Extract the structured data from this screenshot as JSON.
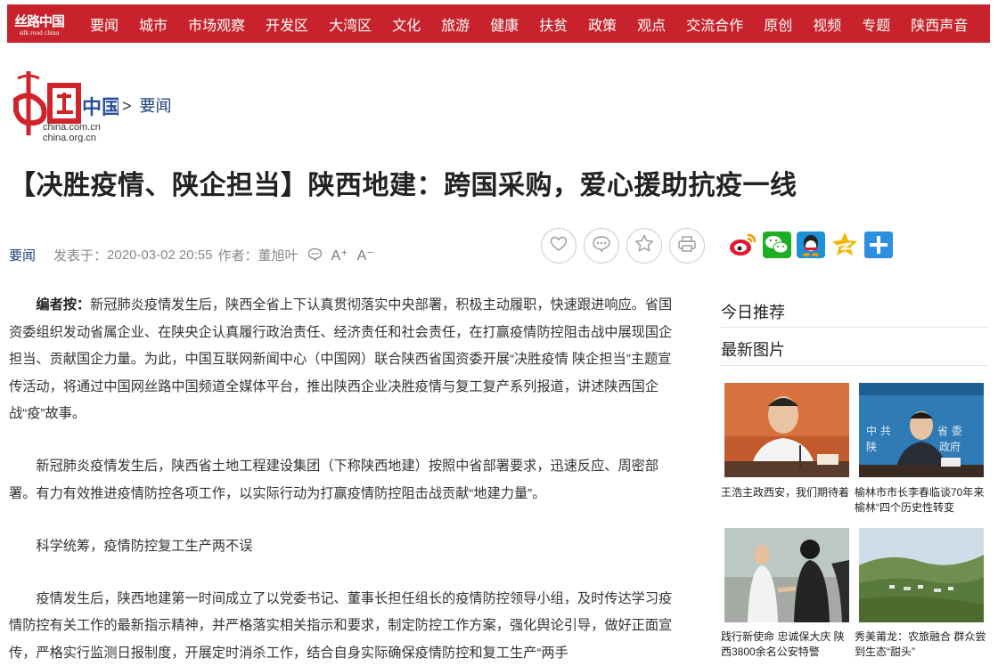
{
  "nav": {
    "logo_text": "丝路中国",
    "logo_sub": "silk road china",
    "items": [
      "要闻",
      "城市",
      "市场观察",
      "开发区",
      "大湾区",
      "文化",
      "旅游",
      "健康",
      "扶贫",
      "政策",
      "观点",
      "交流合作",
      "原创",
      "视频",
      "专题",
      "陕西声音"
    ]
  },
  "site": {
    "logo_main": "中国网",
    "logo_line1": "china.com.cn",
    "logo_line2": "china.org.cn"
  },
  "breadcrumb": {
    "sep": ">",
    "section": "要闻"
  },
  "article": {
    "title": "【决胜疫情、陕企担当】陕西地建：跨国采购，爱心援助抗疫一线",
    "column": "要闻",
    "published_label": "发表于：",
    "published": "2020-03-02 20:55",
    "author_label": "作者：",
    "author": "董旭叶",
    "font_up": "A⁺",
    "font_down": "A⁻",
    "editor_label": "编者按：",
    "editor_note": "新冠肺炎疫情发生后，陕西全省上下认真贯彻落实中央部署，积极主动履职，快速跟进响应。省国资委组织发动省属企业、在陕央企认真履行政治责任、经济责任和社会责任，在打赢疫情防控阻击战中展现国企担当、贡献国企力量。为此，中国互联网新闻中心（中国网）联合陕西省国资委开展“决胜疫情 陕企担当”主题宣传活动，将通过中国网丝路中国频道全媒体平台，推出陕西企业决胜疫情与复工复产系列报道，讲述陕西国企战“疫”故事。",
    "paragraphs": [
      "新冠肺炎疫情发生后，陕西省土地工程建设集团（下称陕西地建）按照中省部署要求，迅速反应、周密部署。有力有效推进疫情防控各项工作，以实际行动为打赢疫情防控阻击战贡献“地建力量”。",
      "科学统筹，疫情防控复工生产两不误",
      "疫情发生后，陕西地建第一时间成立了以党委书记、董事长担任组长的疫情防控领导小组，及时传达学习疫情防控有关工作的最新指示精神，并严格落实相关指示和要求，制定防控工作方案，强化舆论引导，做好正面宣传，严格实行监测日报制度，开展定时消杀工作，结合自身实际确保疫情防控和复工生产“两手"
    ]
  },
  "actions": [
    "like-icon",
    "comment-icon",
    "favorite-icon",
    "print-icon"
  ],
  "share": [
    "weibo-icon",
    "wechat-icon",
    "qq-icon",
    "qzone-icon",
    "more-share-icon"
  ],
  "sidebar": {
    "today_title": "今日推荐",
    "photos_title": "最新图片",
    "photos": [
      {
        "caption": "王浩主政西安，我们期待着"
      },
      {
        "caption": "榆林市市长李春临谈70年来榆林“四个历史性转变"
      },
      {
        "caption": "践行新使命 忠诚保大庆 陕西3800余名公安特警"
      },
      {
        "caption": "秀美莆龙：农旅融合 群众尝到生态“甜头”"
      }
    ]
  },
  "colors": {
    "nav_bg": "#c8232c",
    "link_blue": "#1a3f7a"
  }
}
